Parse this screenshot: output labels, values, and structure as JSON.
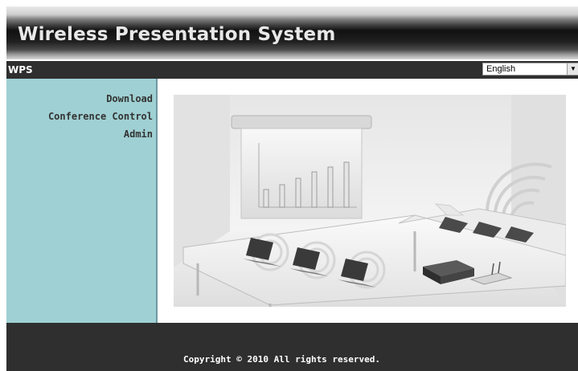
{
  "header": {
    "title": "Wireless Presentation System"
  },
  "navbar": {
    "brand": "WPS",
    "language": {
      "selected": "English",
      "icon": "chevron-down-icon"
    }
  },
  "sidebar": {
    "items": [
      {
        "label": "Download"
      },
      {
        "label": "Conference Control"
      },
      {
        "label": "Admin"
      }
    ]
  },
  "main": {
    "image": "conference-room-illustration"
  },
  "footer": {
    "copyright": "Copyright © 2010 All rights reserved."
  },
  "colors": {
    "navbar": "#2f2f2f",
    "sidebar": "#9fd0d3",
    "sidebar_border": "#6c98a3",
    "footer": "#2f2f2f"
  }
}
